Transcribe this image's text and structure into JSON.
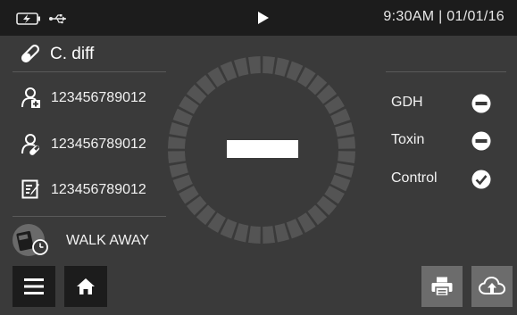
{
  "status_bar": {
    "time_date": "9:30AM | 01/01/16",
    "icons": [
      "battery-charging-icon",
      "usb-icon",
      "play-icon"
    ]
  },
  "test": {
    "title": "C. diff",
    "icon": "test-tube-icon"
  },
  "info_rows": [
    {
      "icon": "patient-icon",
      "value": "123456789012"
    },
    {
      "icon": "operator-icon",
      "value": "123456789012"
    },
    {
      "icon": "notes-icon",
      "value": "123456789012"
    }
  ],
  "mode": {
    "label": "WALK AWAY",
    "icon": "walk-away-icon"
  },
  "overall_result": {
    "symbol": "negative-bar"
  },
  "results": [
    {
      "label": "GDH",
      "status": "negative",
      "icon": "minus-circle-icon"
    },
    {
      "label": "Toxin",
      "status": "negative",
      "icon": "minus-circle-icon"
    },
    {
      "label": "Control",
      "status": "valid",
      "icon": "check-circle-icon"
    }
  ],
  "toolbar": {
    "menu_icon": "menu-icon",
    "home_icon": "home-icon",
    "print_icon": "print-icon",
    "upload_icon": "cloud-upload-icon"
  },
  "colors": {
    "background": "#3a3a3a",
    "status_bar": "#1c1c1c",
    "ring_segment": "#545454",
    "button_gray": "#6c6c6c",
    "text": "#ffffff"
  }
}
